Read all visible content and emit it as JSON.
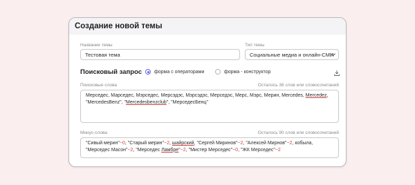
{
  "header": {
    "title": "Создание новой темы"
  },
  "theme_name": {
    "label": "Название темы",
    "value": "Тестовая тема"
  },
  "theme_type": {
    "label": "Тип темы",
    "value": "Социальные медиа и онлайн-СМИ"
  },
  "search_query": {
    "title": "Поисковый запрос",
    "options": [
      "форма с операторами",
      "форма - конструктор"
    ],
    "selected": "форма с операторами"
  },
  "search_words": {
    "label": "Поисковые слова",
    "counter": "Осталось 36 слов или словосочетаний",
    "line1_plain": "Мерседес, Марседес, Мэрседес, Мерсэдэс, Мэрсэдэс, Мерседэс, Мерс, Мэрс, Мерин, Mercedes, ",
    "line1_underlined": "Mercedez",
    "line1_end": ",",
    "line2_a": "\"MercedesBenz\", \"",
    "line2_underlined": "Mercedesbenzclub",
    "line2_b": "\", \"МерседесБенц\""
  },
  "minus_words": {
    "label": "Минус-слова",
    "counter": "Осталось 90 слов или словосочетаний",
    "l1_a": "\"Сивый мерин\"",
    "l1_op1": "~0",
    "l1_b": ", \"Старый мерин\"",
    "l1_op2": "~2",
    "l1_c": ", ",
    "l1_u": "шайрский",
    "l1_d": ", \"Сергей Миринов\"",
    "l1_op3": "~2",
    "l1_e": ", \"Алексей Мирнов\"",
    "l1_op4": "~2",
    "l1_f": ", кобыла,",
    "l2_a": "\"Мерседес Масон\"",
    "l2_op1": "~2",
    "l2_b": ", \"Мерседес ",
    "l2_u": "Ламбре",
    "l2_c": "\"",
    "l2_op2": "~2",
    "l2_d": ", \"Мистер Мерседес\"",
    "l2_op3": "~0",
    "l2_e": ", \"ЖК Мерседес\"",
    "l2_op4": "~2"
  },
  "colors": {
    "accent": "#5b62e6",
    "error_underline": "#d23c3c",
    "background": "#fbeeee"
  }
}
